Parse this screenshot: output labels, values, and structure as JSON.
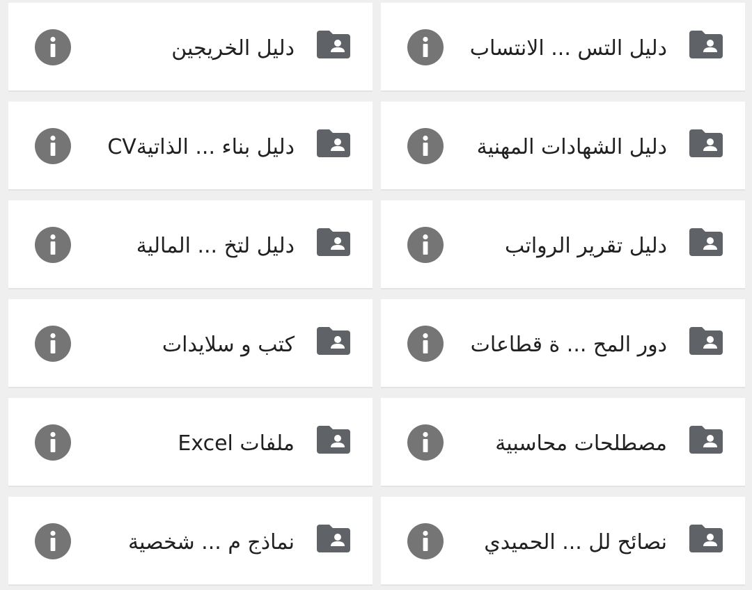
{
  "colors": {
    "background": "#efefef",
    "card": "#ffffff",
    "icon": "#5f6368",
    "info_icon": "#757575",
    "text": "#202020"
  },
  "folders": [
    {
      "label": "دليل التس ... الانتساب",
      "icon": "shared-folder-icon",
      "info": "info-icon"
    },
    {
      "label": "دليل الخريجين",
      "icon": "shared-folder-icon",
      "info": "info-icon"
    },
    {
      "label": "دليل الشهادات المهنية",
      "icon": "shared-folder-icon",
      "info": "info-icon"
    },
    {
      "label": "دليل بناء ... الذاتيةCV",
      "icon": "shared-folder-icon",
      "info": "info-icon"
    },
    {
      "label": "دليل تقرير الرواتب",
      "icon": "shared-folder-icon",
      "info": "info-icon"
    },
    {
      "label": "دليل لتخ ... المالية",
      "icon": "shared-folder-icon",
      "info": "info-icon"
    },
    {
      "label": "دور المح ... ة قطاعات",
      "icon": "shared-folder-icon",
      "info": "info-icon"
    },
    {
      "label": "كتب و سلايدات",
      "icon": "shared-folder-icon",
      "info": "info-icon"
    },
    {
      "label": "مصطلحات محاسبية",
      "icon": "shared-folder-icon",
      "info": "info-icon"
    },
    {
      "label": "ملفات Excel",
      "icon": "shared-folder-icon",
      "info": "info-icon"
    },
    {
      "label": "نصائح لل ... الحميدي",
      "icon": "shared-folder-icon",
      "info": "info-icon"
    },
    {
      "label": "نماذج م ... شخصية",
      "icon": "shared-folder-icon",
      "info": "info-icon"
    }
  ]
}
